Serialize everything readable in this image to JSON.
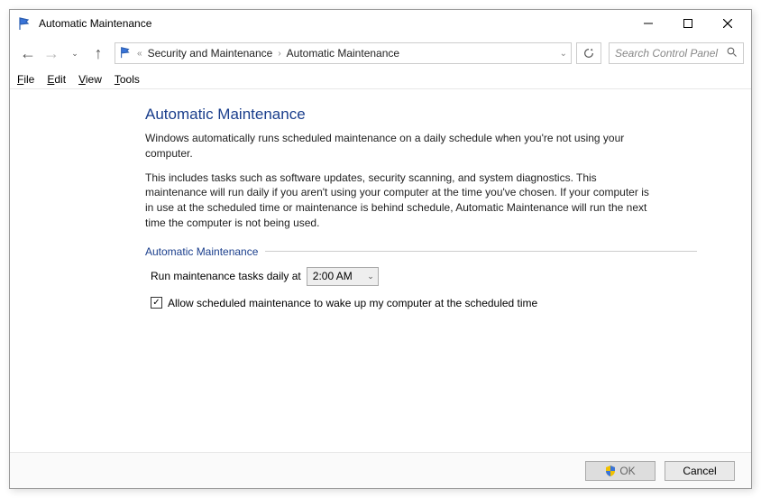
{
  "window": {
    "title": "Automatic Maintenance"
  },
  "breadcrumb": {
    "parent": "Security and Maintenance",
    "current": "Automatic Maintenance"
  },
  "search": {
    "placeholder": "Search Control Panel"
  },
  "menubar": [
    "File",
    "Edit",
    "View",
    "Tools"
  ],
  "main": {
    "heading": "Automatic Maintenance",
    "para1": "Windows automatically runs scheduled maintenance on a daily schedule when you're not using your computer.",
    "para2": "This includes tasks such as software updates, security scanning, and system diagnostics. This maintenance will run daily if you aren't using your computer at the time you've chosen. If your computer is in use at the scheduled time or maintenance is behind schedule, Automatic Maintenance will run the next time the computer is not being used.",
    "section_title": "Automatic Maintenance",
    "run_label": "Run maintenance tasks daily at",
    "time_value": "2:00 AM",
    "wake_checked": true,
    "wake_label": "Allow scheduled maintenance to wake up my computer at the scheduled time"
  },
  "buttons": {
    "ok": "OK",
    "cancel": "Cancel"
  }
}
